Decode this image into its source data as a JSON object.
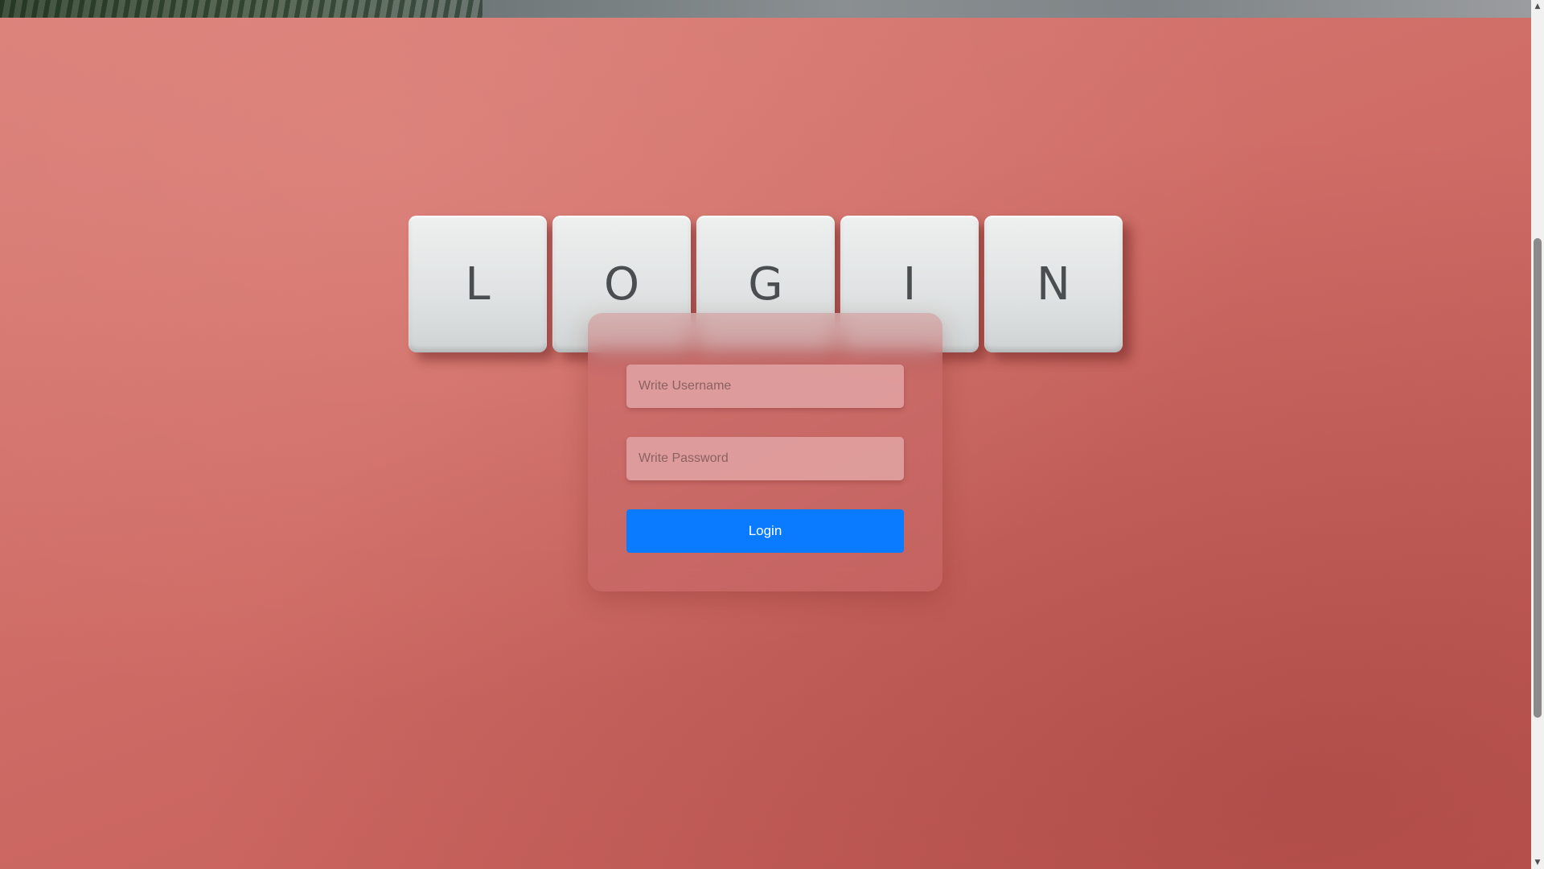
{
  "page": {
    "background_color": "#cf6d67",
    "accent_color": "#0a7bff"
  },
  "decoration": {
    "key_letters": [
      "L",
      "O",
      "G",
      "I",
      "N"
    ]
  },
  "login_form": {
    "username_placeholder": "Write Username",
    "password_placeholder": "Write Password",
    "username_value": "",
    "password_value": "",
    "submit_label": "Login"
  },
  "scrollbar": {
    "up_arrow": "▲",
    "down_arrow": "▼"
  }
}
